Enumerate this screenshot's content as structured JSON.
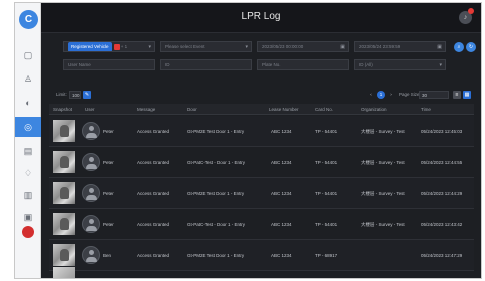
{
  "app": {
    "title": "LPR Log",
    "logo_glyph": "C"
  },
  "colors": {
    "accent": "#3d86e0",
    "chip": "#2b6fd6",
    "danger": "#e53935",
    "background": "#1d1f23"
  },
  "sidebar": {
    "items": [
      {
        "name": "monitor-icon",
        "glyph": "▢"
      },
      {
        "name": "user-icon",
        "glyph": "♙"
      },
      {
        "name": "device-icon",
        "glyph": "◐"
      },
      {
        "name": "lpr-log-icon",
        "glyph": "◎",
        "active": true
      },
      {
        "name": "calendar-icon",
        "glyph": "▤"
      },
      {
        "name": "alarm-icon",
        "glyph": "♢"
      },
      {
        "name": "report-icon",
        "glyph": "▥"
      },
      {
        "name": "settings-icon",
        "glyph": "▣"
      }
    ]
  },
  "filters": {
    "register_chip": "Registered Vehicle",
    "register_extra": "+ 1",
    "event_type_placeholder": "Please select Event",
    "start_time": "2023/05/23 00:00:00",
    "end_time": "2023/05/24 23:59:59",
    "user_name_placeholder": "User Name",
    "plate_placeholder": "ID",
    "plate_no_placeholder": "Plate No.",
    "device_value": "ID (All)"
  },
  "toolbar": {
    "limit_label": "Limit:",
    "limit_value": "100",
    "current_page": "1",
    "page_size_label": "Page Size:",
    "page_size_value": "30"
  },
  "table": {
    "headers": [
      "Snapshot",
      "User",
      "Message",
      "Door",
      "Lease Number",
      "Card No.",
      "Organization",
      "Time"
    ],
    "rows": [
      {
        "user": "Peter",
        "message": "Access Granted",
        "door": "Gt-PM2E Test Door 1 - Entry",
        "lease": "ABC 1234",
        "card": "TP - 54401",
        "org": "大楼层 - Survey - Test",
        "time": "05/24/2023 12:45:03"
      },
      {
        "user": "Peter",
        "message": "Access Granted",
        "door": "Gt-PatC-Test - Door 1 - Entry",
        "lease": "ABC 1234",
        "card": "TP - 54401",
        "org": "大楼层 - Survey - Test",
        "time": "05/24/2023 12:44:55"
      },
      {
        "user": "Peter",
        "message": "Access Granted",
        "door": "Gt-PM2E Test Door 1 - Entry",
        "lease": "ABC 1234",
        "card": "TP - 54401",
        "org": "大楼层 - Survey - Test",
        "time": "05/24/2023 12:44:29"
      },
      {
        "user": "Peter",
        "message": "Access Granted",
        "door": "Gt-PatC-Test - Door 1 - Entry",
        "lease": "ABC 1234",
        "card": "TP - 54401",
        "org": "大楼层 - Survey - Test",
        "time": "05/24/2023 12:43:42"
      },
      {
        "user": "Ben",
        "message": "Access Granted",
        "door": "Gt-PM2E Test Door 1 - Entry",
        "lease": "ABC 1234",
        "card": "TP - 68917",
        "org": "",
        "time": "05/24/2023 12:47:29"
      }
    ]
  }
}
